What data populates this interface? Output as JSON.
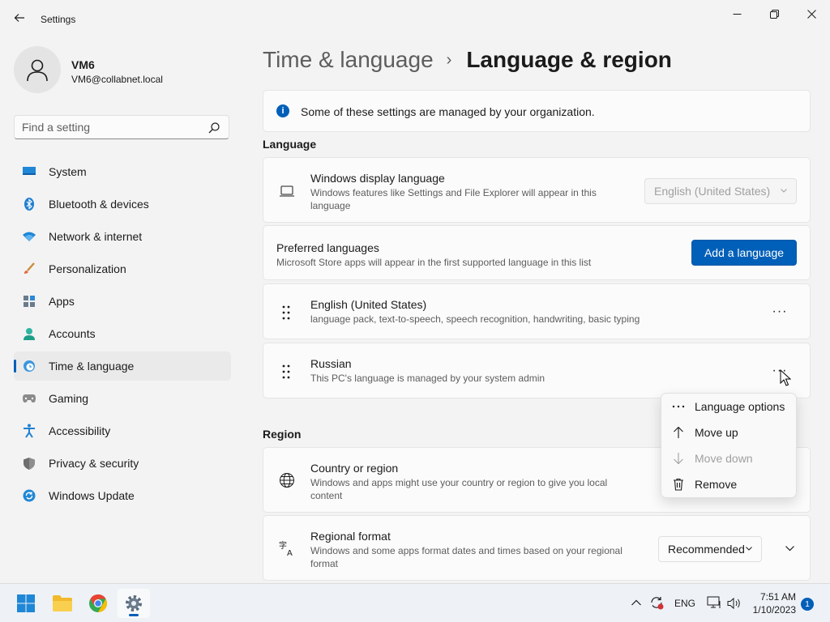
{
  "window": {
    "title": "Settings"
  },
  "profile": {
    "name": "VM6",
    "email": "VM6@collabnet.local"
  },
  "search": {
    "placeholder": "Find a setting"
  },
  "sidebar": {
    "items": [
      {
        "label": "System",
        "icon": "monitor-icon",
        "active": false
      },
      {
        "label": "Bluetooth & devices",
        "icon": "bluetooth-icon",
        "active": false
      },
      {
        "label": "Network & internet",
        "icon": "wifi-icon",
        "active": false
      },
      {
        "label": "Personalization",
        "icon": "brush-icon",
        "active": false
      },
      {
        "label": "Apps",
        "icon": "apps-icon",
        "active": false
      },
      {
        "label": "Accounts",
        "icon": "person-icon",
        "active": false
      },
      {
        "label": "Time & language",
        "icon": "globe-clock-icon",
        "active": true
      },
      {
        "label": "Gaming",
        "icon": "gamepad-icon",
        "active": false
      },
      {
        "label": "Accessibility",
        "icon": "accessibility-icon",
        "active": false
      },
      {
        "label": "Privacy & security",
        "icon": "shield-icon",
        "active": false
      },
      {
        "label": "Windows Update",
        "icon": "update-icon",
        "active": false
      }
    ]
  },
  "breadcrumb": {
    "parent": "Time & language",
    "separator": "›",
    "current": "Language & region"
  },
  "info_bar": {
    "text": "Some of these settings are managed by your organization."
  },
  "language_section": {
    "label": "Language",
    "display_language": {
      "title": "Windows display language",
      "subtitle": "Windows features like Settings and File Explorer will appear in this language",
      "value": "English (United States)"
    },
    "preferred": {
      "title": "Preferred languages",
      "subtitle": "Microsoft Store apps will appear in the first supported language in this list",
      "add_button": "Add a language"
    },
    "languages": [
      {
        "name": "English (United States)",
        "detail": "language pack, text-to-speech, speech recognition, handwriting, basic typing"
      },
      {
        "name": "Russian",
        "detail": "This PC's language is managed by your system admin"
      }
    ],
    "more_glyph": "···"
  },
  "context_menu": {
    "items": [
      {
        "label": "Language options",
        "icon": "more-icon",
        "disabled": false
      },
      {
        "label": "Move up",
        "icon": "arrow-up-icon",
        "disabled": false
      },
      {
        "label": "Move down",
        "icon": "arrow-down-icon",
        "disabled": true
      },
      {
        "label": "Remove",
        "icon": "trash-icon",
        "disabled": false
      }
    ]
  },
  "region_section": {
    "label": "Region",
    "country": {
      "title": "Country or region",
      "subtitle": "Windows and apps might use your country or region to give you local content"
    },
    "format": {
      "title": "Regional format",
      "subtitle": "Windows and some apps format dates and times based on your regional format",
      "value": "Recommended"
    }
  },
  "taskbar": {
    "language": "ENG",
    "time": "7:51 AM",
    "date": "1/10/2023",
    "notifications": "1"
  },
  "colors": {
    "accent": "#005fb8",
    "background": "#f3f3f3",
    "card": "#fbfbfb"
  }
}
